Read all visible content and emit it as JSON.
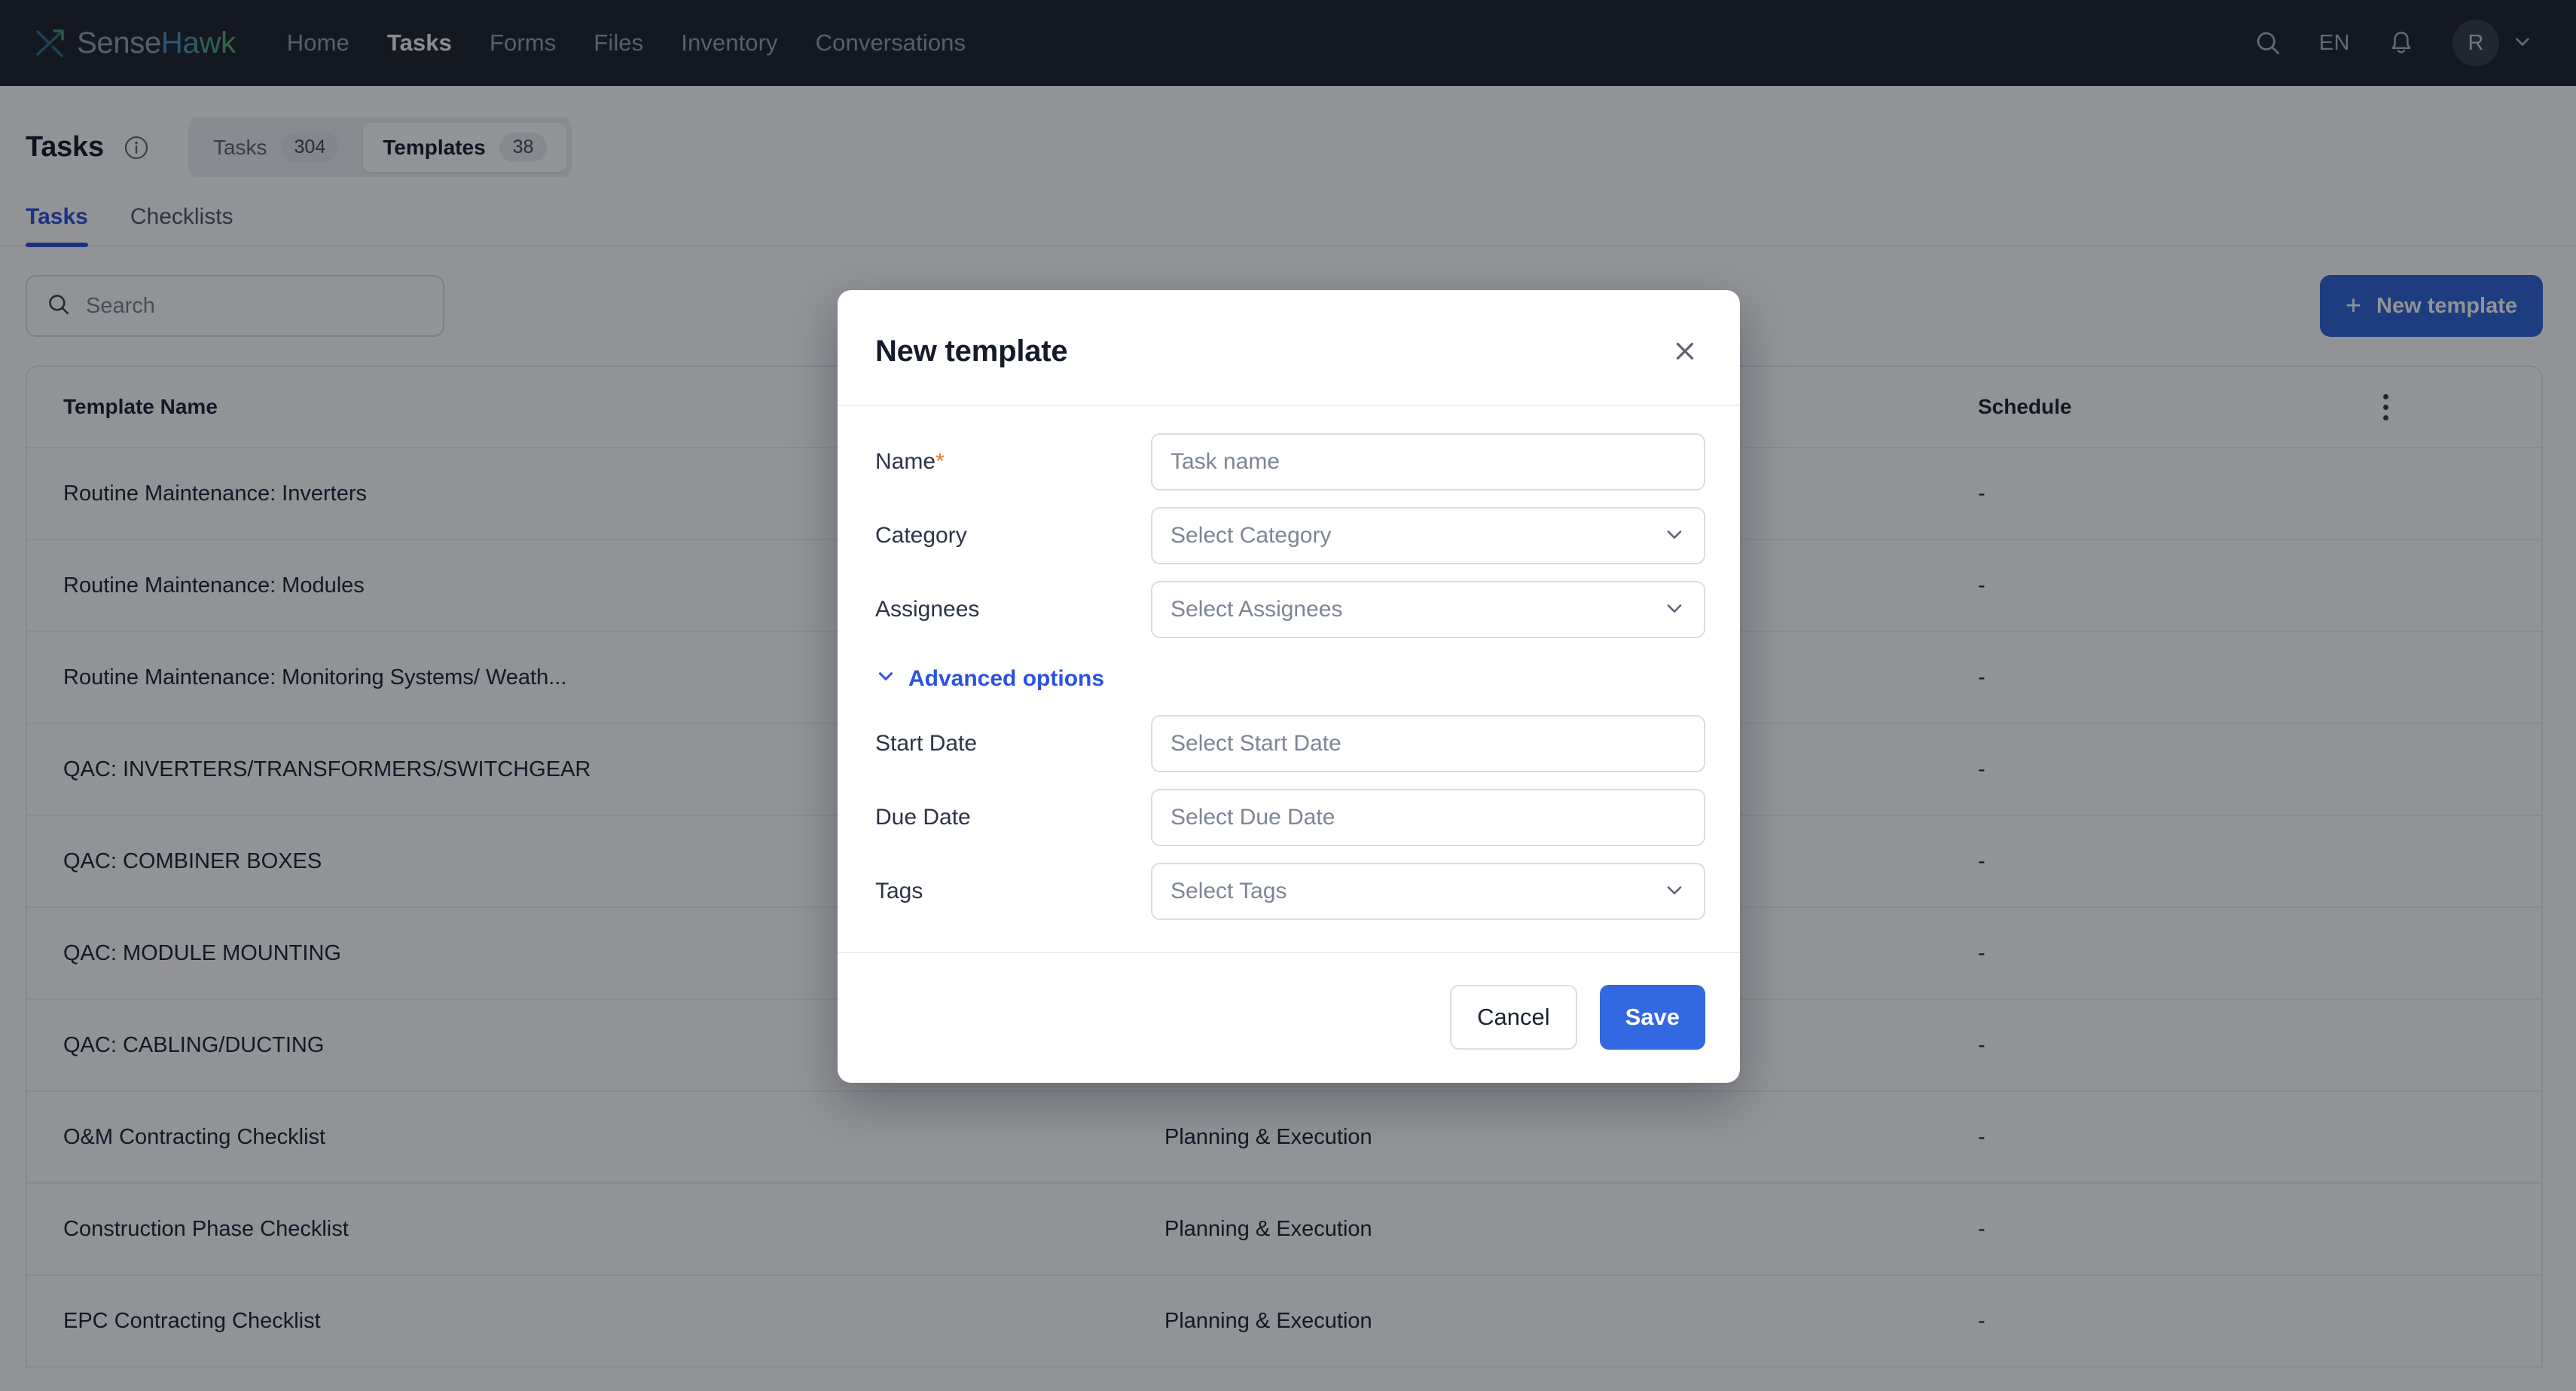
{
  "topnav": {
    "logo": {
      "part1": "Sense",
      "part2": "H",
      "part3": "a",
      "part4": "w",
      "part5": "k"
    },
    "links": [
      {
        "label": "Home",
        "active": false
      },
      {
        "label": "Tasks",
        "active": true
      },
      {
        "label": "Forms",
        "active": false
      },
      {
        "label": "Files",
        "active": false
      },
      {
        "label": "Inventory",
        "active": false
      },
      {
        "label": "Conversations",
        "active": false
      }
    ],
    "language": "EN",
    "avatar_initial": "R"
  },
  "page_header": {
    "title": "Tasks",
    "segments": [
      {
        "label": "Tasks",
        "count": "304",
        "active": false
      },
      {
        "label": "Templates",
        "count": "38",
        "active": true
      }
    ]
  },
  "subtabs": [
    {
      "label": "Tasks",
      "active": true
    },
    {
      "label": "Checklists",
      "active": false
    }
  ],
  "toolbar": {
    "search_placeholder": "Search",
    "search_value": "",
    "new_template_label": "New template"
  },
  "table": {
    "columns": [
      "Template Name",
      "",
      "Schedule"
    ],
    "rows": [
      {
        "name": "Routine Maintenance: Inverters",
        "category": "",
        "schedule": "-"
      },
      {
        "name": "Routine Maintenance: Modules",
        "category": "",
        "schedule": "-"
      },
      {
        "name": "Routine Maintenance: Monitoring Systems/ Weath...",
        "category": "",
        "schedule": "-"
      },
      {
        "name": "QAC: INVERTERS/TRANSFORMERS/SWITCHGEAR",
        "category": "",
        "schedule": "-"
      },
      {
        "name": "QAC: COMBINER BOXES",
        "category": "",
        "schedule": "-"
      },
      {
        "name": "QAC: MODULE MOUNTING",
        "category": "",
        "schedule": "-"
      },
      {
        "name": "QAC: CABLING/DUCTING",
        "category": "",
        "schedule": "-"
      },
      {
        "name": "O&M Contracting Checklist",
        "category": "Planning & Execution",
        "schedule": "-"
      },
      {
        "name": "Construction Phase Checklist",
        "category": "Planning & Execution",
        "schedule": "-"
      },
      {
        "name": "EPC Contracting Checklist",
        "category": "Planning & Execution",
        "schedule": "-"
      }
    ]
  },
  "modal": {
    "title": "New template",
    "fields": [
      {
        "label": "Name",
        "required": true,
        "placeholder": "Task name",
        "value": "",
        "type": "input"
      },
      {
        "label": "Category",
        "required": false,
        "placeholder": "Select Category",
        "value": "",
        "type": "select"
      },
      {
        "label": "Assignees",
        "required": false,
        "placeholder": "Select Assignees",
        "value": "",
        "type": "select"
      }
    ],
    "advanced_label": "Advanced options",
    "advanced_expanded": true,
    "advanced_fields": [
      {
        "label": "Start Date",
        "required": false,
        "placeholder": "Select Start Date",
        "value": "",
        "type": "input"
      },
      {
        "label": "Due Date",
        "required": false,
        "placeholder": "Select Due Date",
        "value": "",
        "type": "input"
      },
      {
        "label": "Tags",
        "required": false,
        "placeholder": "Select Tags",
        "value": "",
        "type": "select"
      }
    ],
    "cancel_label": "Cancel",
    "save_label": "Save"
  },
  "colors": {
    "nav_bg": "#1c2029",
    "accent_blue": "#2d4fd6",
    "primary_button": "#3268e0",
    "required_asterisk": "#e07c28",
    "new_button": "#2f62d6"
  }
}
